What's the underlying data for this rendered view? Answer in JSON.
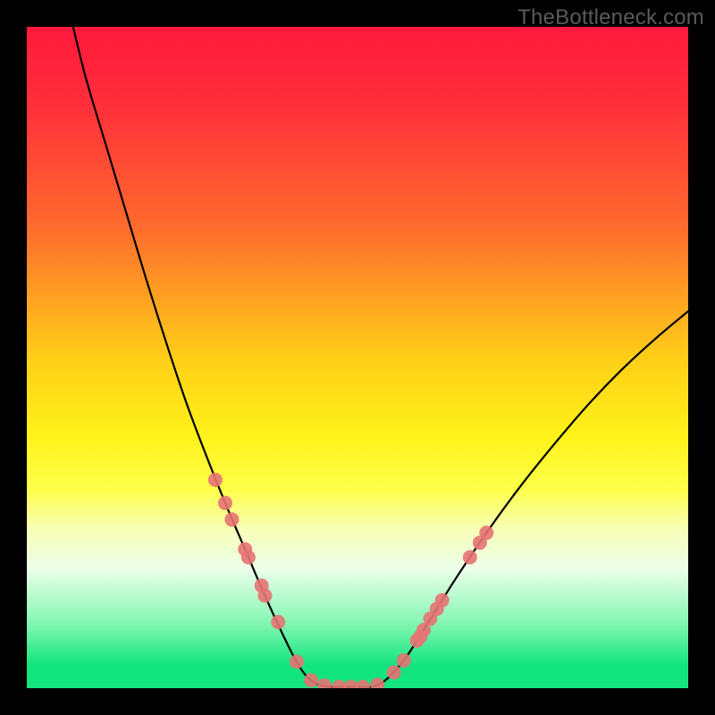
{
  "watermark": "TheBottleneck.com",
  "chart_data": {
    "type": "line",
    "title": "",
    "xlabel": "",
    "ylabel": "",
    "xlim": [
      0,
      100
    ],
    "ylim": [
      0,
      100
    ],
    "gradient_stops": [
      {
        "offset": 0.0,
        "color": "#ff193d"
      },
      {
        "offset": 0.12,
        "color": "#ff2f3a"
      },
      {
        "offset": 0.3,
        "color": "#ff6a2e"
      },
      {
        "offset": 0.5,
        "color": "#ffce18"
      },
      {
        "offset": 0.62,
        "color": "#fff21a"
      },
      {
        "offset": 0.7,
        "color": "#fdff4a"
      },
      {
        "offset": 0.76,
        "color": "#f8ffb8"
      },
      {
        "offset": 0.82,
        "color": "#ecffea"
      },
      {
        "offset": 0.9,
        "color": "#86f7b4"
      },
      {
        "offset": 0.965,
        "color": "#12e57e"
      },
      {
        "offset": 1.0,
        "color": "#14e57f"
      }
    ],
    "curve_left": [
      {
        "x": 7.0,
        "y": 100.0
      },
      {
        "x": 9.0,
        "y": 92.0
      },
      {
        "x": 12.0,
        "y": 82.0
      },
      {
        "x": 15.0,
        "y": 72.0
      },
      {
        "x": 18.0,
        "y": 62.0
      },
      {
        "x": 21.0,
        "y": 52.5
      },
      {
        "x": 24.0,
        "y": 43.5
      },
      {
        "x": 27.0,
        "y": 35.5
      },
      {
        "x": 30.0,
        "y": 28.0
      },
      {
        "x": 33.0,
        "y": 21.0
      },
      {
        "x": 36.0,
        "y": 14.0
      },
      {
        "x": 39.0,
        "y": 7.5
      },
      {
        "x": 41.0,
        "y": 3.6
      },
      {
        "x": 42.5,
        "y": 1.6
      },
      {
        "x": 44.0,
        "y": 0.6
      },
      {
        "x": 46.0,
        "y": 0.2
      }
    ],
    "curve_bottom": [
      {
        "x": 46.0,
        "y": 0.2
      },
      {
        "x": 48.0,
        "y": 0.2
      },
      {
        "x": 50.0,
        "y": 0.2
      },
      {
        "x": 52.0,
        "y": 0.2
      }
    ],
    "curve_right": [
      {
        "x": 52.0,
        "y": 0.2
      },
      {
        "x": 53.5,
        "y": 0.7
      },
      {
        "x": 55.0,
        "y": 1.9
      },
      {
        "x": 57.0,
        "y": 4.2
      },
      {
        "x": 59.0,
        "y": 7.2
      },
      {
        "x": 62.0,
        "y": 12.0
      },
      {
        "x": 65.0,
        "y": 16.8
      },
      {
        "x": 70.0,
        "y": 24.2
      },
      {
        "x": 75.0,
        "y": 31.0
      },
      {
        "x": 80.0,
        "y": 37.2
      },
      {
        "x": 85.0,
        "y": 43.0
      },
      {
        "x": 90.0,
        "y": 48.2
      },
      {
        "x": 95.0,
        "y": 52.8
      },
      {
        "x": 100.0,
        "y": 57.0
      }
    ],
    "markers": [
      {
        "x": 28.5,
        "y": 31.5
      },
      {
        "x": 30.0,
        "y": 28.0
      },
      {
        "x": 31.0,
        "y": 25.5
      },
      {
        "x": 33.0,
        "y": 21.0
      },
      {
        "x": 33.5,
        "y": 19.8
      },
      {
        "x": 35.5,
        "y": 15.5
      },
      {
        "x": 36.0,
        "y": 14.0
      },
      {
        "x": 38.0,
        "y": 10.0
      },
      {
        "x": 40.8,
        "y": 4.0
      },
      {
        "x": 43.0,
        "y": 1.2
      },
      {
        "x": 45.0,
        "y": 0.4
      },
      {
        "x": 47.2,
        "y": 0.2
      },
      {
        "x": 49.0,
        "y": 0.2
      },
      {
        "x": 50.8,
        "y": 0.2
      },
      {
        "x": 53.0,
        "y": 0.5
      },
      {
        "x": 55.5,
        "y": 2.4
      },
      {
        "x": 57.0,
        "y": 4.2
      },
      {
        "x": 59.0,
        "y": 7.2
      },
      {
        "x": 59.5,
        "y": 7.8
      },
      {
        "x": 60.0,
        "y": 8.8
      },
      {
        "x": 61.0,
        "y": 10.5
      },
      {
        "x": 62.0,
        "y": 12.0
      },
      {
        "x": 62.8,
        "y": 13.3
      },
      {
        "x": 67.0,
        "y": 19.8
      },
      {
        "x": 68.5,
        "y": 22.0
      },
      {
        "x": 69.5,
        "y": 23.5
      }
    ],
    "marker_style": {
      "radius": 8,
      "fill": "#e57373",
      "opacity": 0.9
    },
    "line_style": {
      "stroke": "#000000",
      "width": 2.2
    }
  }
}
